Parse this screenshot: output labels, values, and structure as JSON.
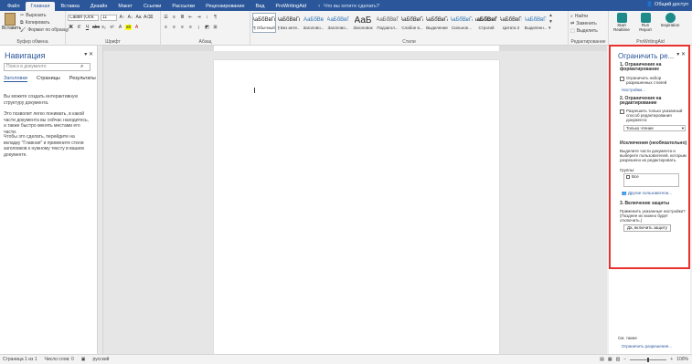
{
  "tabs": [
    "Файл",
    "Главная",
    "Вставка",
    "Дизайн",
    "Макет",
    "Ссылки",
    "Рассылки",
    "Рецензирование",
    "Вид",
    "ProWritingAid"
  ],
  "tell_me": "Что вы хотите сделать?",
  "share": "Общий доступ",
  "clipboard": {
    "paste": "Вставить",
    "cut": "Вырезать",
    "copy": "Копировать",
    "format_painter": "Формат по образцу",
    "label": "Буфер обмена"
  },
  "font": {
    "name": "Calibri (Осн.",
    "size": "11",
    "label": "Шрифт"
  },
  "paragraph": {
    "label": "Абзац"
  },
  "styles": {
    "label": "Стили",
    "items": [
      {
        "preview": "АаБбВвГг,",
        "name": "¶ Обычный"
      },
      {
        "preview": "АаБбВвГг,",
        "name": "¶ Без инте..."
      },
      {
        "preview": "АаБбВв",
        "name": "Заголово..."
      },
      {
        "preview": "АаБбВвГ",
        "name": "Заголово..."
      },
      {
        "preview": "АаБ",
        "name": "Заголовок"
      },
      {
        "preview": "АаБбВвГ",
        "name": "Подзагол..."
      },
      {
        "preview": "АаБбВвГг",
        "name": "Слабое в..."
      },
      {
        "preview": "АаБбВвГг",
        "name": "Выделение"
      },
      {
        "preview": "АаБбВвГг",
        "name": "Сильное..."
      },
      {
        "preview": "АаБбВвГг",
        "name": "Строгий"
      },
      {
        "preview": "АаБбВвГг",
        "name": "Цитата 2"
      },
      {
        "preview": "АаБбВвГг",
        "name": "Выделенн..."
      }
    ]
  },
  "editing": {
    "find": "Найти",
    "replace": "Заменить",
    "select": "Выделить",
    "label": "Редактирование"
  },
  "pwa": {
    "start": "Start Realtime",
    "run": "Run Report",
    "inspiration": "Inspiration",
    "label": "ProWritingAid"
  },
  "nav": {
    "title": "Навигация",
    "search_placeholder": "Поиск в документе",
    "tabs": [
      "Заголовки",
      "Страницы",
      "Результаты"
    ],
    "text1": "Вы можете создать интерактивную структуру документа.",
    "text2": "Это позволит легко понимать, в какой части документа вы сейчас находитесь, а также быстро менять местами его части.",
    "text3": "Чтобы это сделать, перейдите на вкладку \"Главная\" и примените стили заголовков к нужному тексту в вашем документе."
  },
  "restrict": {
    "title": "Ограничить ре...",
    "s1_head": "1. Ограничения на форматирование",
    "s1_check": "Ограничить набор разрешенных стилей",
    "s1_link": "Настройки...",
    "s2_head": "2. Ограничения на редактирование",
    "s2_check": "Разрешить только указанный способ редактирования документа:",
    "s2_select": "Только чтение",
    "exc_head": "Исключения (необязательно)",
    "exc_text": "Выделите части документа и выберите пользователей, которым разрешено их редактировать.",
    "groups": "Группы:",
    "group_item": "Все",
    "other_users": "Другие пользователи...",
    "s3_head": "3. Включение защиты",
    "s3_text": "Применить указанные настройки? (Позднее их можно будет отключить.)",
    "s3_button": "Да, включить защиту",
    "see_also": "См. также",
    "restrict_link": "Ограничить разрешения..."
  },
  "status": {
    "page": "Страница 1 из 1",
    "words": "Число слов: 0",
    "lang": "русский",
    "zoom": "100%"
  }
}
